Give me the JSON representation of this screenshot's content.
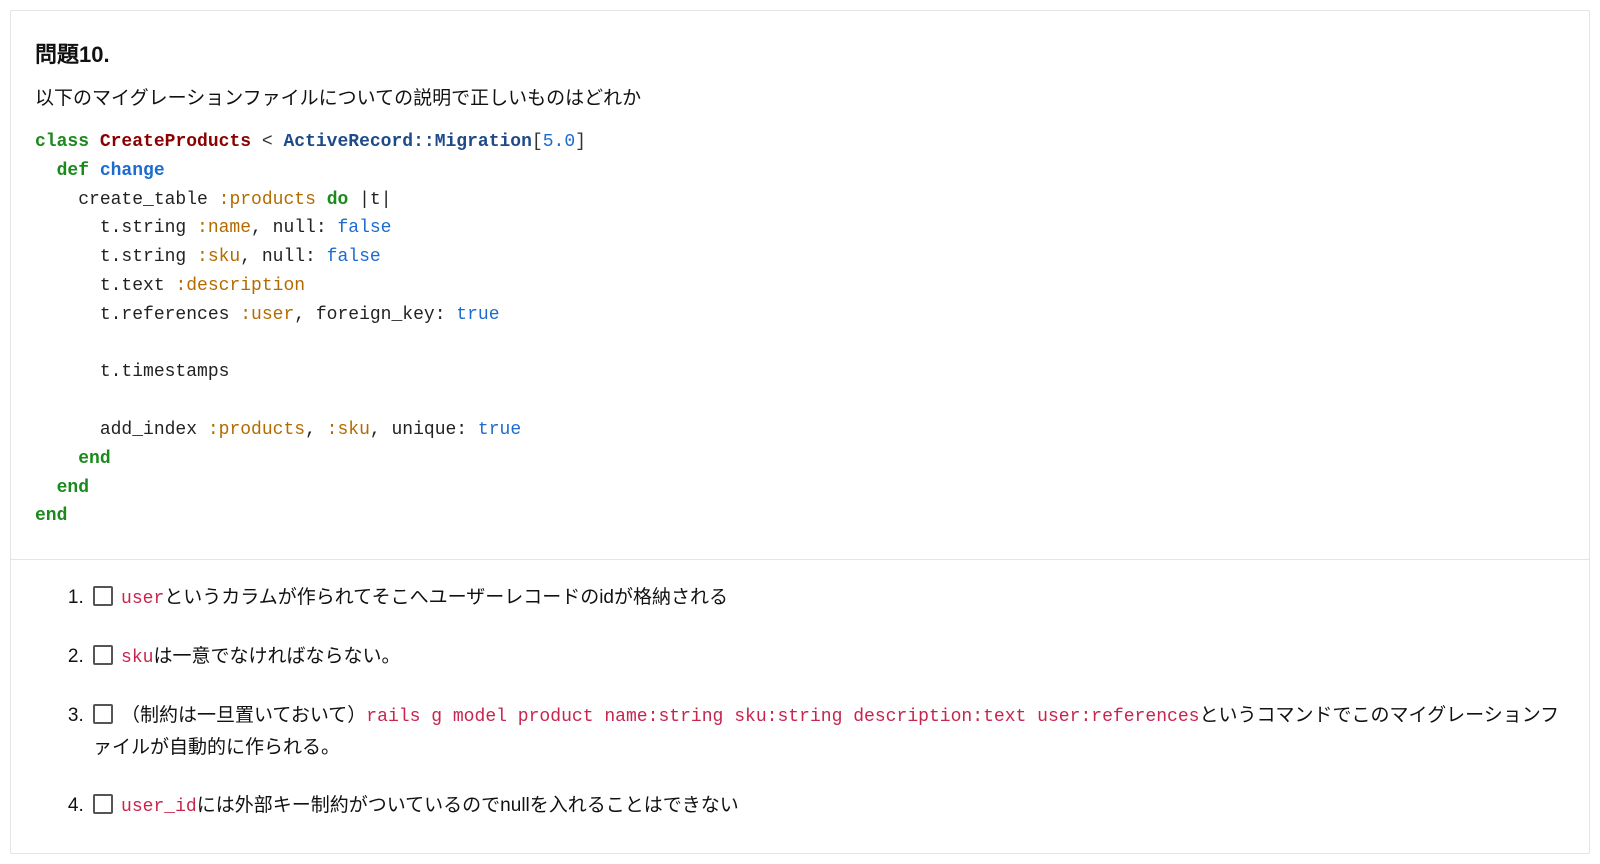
{
  "question": {
    "title": "問題10.",
    "description": "以下のマイグレーションファイルについての説明で正しいものはどれか",
    "code": {
      "lines": [
        {
          "indent": 0,
          "tokens": [
            {
              "t": "class",
              "c": "tok-kw"
            },
            {
              "t": " ",
              "c": "tok-plain"
            },
            {
              "t": "CreateProducts",
              "c": "tok-cls"
            },
            {
              "t": " < ",
              "c": "tok-op"
            },
            {
              "t": "ActiveRecord::Migration",
              "c": "tok-cls2"
            },
            {
              "t": "[",
              "c": "tok-op"
            },
            {
              "t": "5.0",
              "c": "tok-num"
            },
            {
              "t": "]",
              "c": "tok-op"
            }
          ]
        },
        {
          "indent": 1,
          "tokens": [
            {
              "t": "def",
              "c": "tok-kw"
            },
            {
              "t": " ",
              "c": "tok-plain"
            },
            {
              "t": "change",
              "c": "tok-mth"
            }
          ]
        },
        {
          "indent": 2,
          "tokens": [
            {
              "t": "create_table ",
              "c": "tok-plain"
            },
            {
              "t": ":products",
              "c": "tok-sym"
            },
            {
              "t": " ",
              "c": "tok-plain"
            },
            {
              "t": "do",
              "c": "tok-kw"
            },
            {
              "t": " |t|",
              "c": "tok-plain"
            }
          ]
        },
        {
          "indent": 3,
          "tokens": [
            {
              "t": "t.string ",
              "c": "tok-plain"
            },
            {
              "t": ":name",
              "c": "tok-sym"
            },
            {
              "t": ", null: ",
              "c": "tok-plain"
            },
            {
              "t": "false",
              "c": "tok-bool"
            }
          ]
        },
        {
          "indent": 3,
          "tokens": [
            {
              "t": "t.string ",
              "c": "tok-plain"
            },
            {
              "t": ":sku",
              "c": "tok-sym"
            },
            {
              "t": ", null: ",
              "c": "tok-plain"
            },
            {
              "t": "false",
              "c": "tok-bool"
            }
          ]
        },
        {
          "indent": 3,
          "tokens": [
            {
              "t": "t.text ",
              "c": "tok-plain"
            },
            {
              "t": ":description",
              "c": "tok-sym"
            }
          ]
        },
        {
          "indent": 3,
          "tokens": [
            {
              "t": "t.references ",
              "c": "tok-plain"
            },
            {
              "t": ":user",
              "c": "tok-sym"
            },
            {
              "t": ", foreign_key: ",
              "c": "tok-plain"
            },
            {
              "t": "true",
              "c": "tok-bool"
            }
          ]
        },
        {
          "indent": 0,
          "tokens": [
            {
              "t": "",
              "c": "tok-plain"
            }
          ]
        },
        {
          "indent": 3,
          "tokens": [
            {
              "t": "t.timestamps",
              "c": "tok-plain"
            }
          ]
        },
        {
          "indent": 0,
          "tokens": [
            {
              "t": "",
              "c": "tok-plain"
            }
          ]
        },
        {
          "indent": 3,
          "tokens": [
            {
              "t": "add_index ",
              "c": "tok-plain"
            },
            {
              "t": ":products",
              "c": "tok-sym"
            },
            {
              "t": ", ",
              "c": "tok-plain"
            },
            {
              "t": ":sku",
              "c": "tok-sym"
            },
            {
              "t": ", unique: ",
              "c": "tok-plain"
            },
            {
              "t": "true",
              "c": "tok-bool"
            }
          ]
        },
        {
          "indent": 2,
          "tokens": [
            {
              "t": "end",
              "c": "tok-kw"
            }
          ]
        },
        {
          "indent": 1,
          "tokens": [
            {
              "t": "end",
              "c": "tok-kw"
            }
          ]
        },
        {
          "indent": 0,
          "tokens": [
            {
              "t": "end",
              "c": "tok-kw"
            }
          ]
        }
      ],
      "indent_unit": "  "
    },
    "options": [
      {
        "segments": [
          {
            "type": "code",
            "text": "user"
          },
          {
            "type": "text",
            "text": "というカラムが作られてそこへユーザーレコードのidが格納される"
          }
        ]
      },
      {
        "segments": [
          {
            "type": "code",
            "text": "sku"
          },
          {
            "type": "text",
            "text": "は一意でなければならない。"
          }
        ]
      },
      {
        "segments": [
          {
            "type": "text",
            "text": "（制約は一旦置いておいて）"
          },
          {
            "type": "code",
            "text": "rails g model product name:string sku:string description:text user:references"
          },
          {
            "type": "text",
            "text": "というコマンドでこのマイグレーションファイルが自動的に作られる。"
          }
        ]
      },
      {
        "segments": [
          {
            "type": "code",
            "text": "user_id"
          },
          {
            "type": "text",
            "text": "には外部キー制約がついているのでnullを入れることはできない"
          }
        ]
      }
    ]
  }
}
